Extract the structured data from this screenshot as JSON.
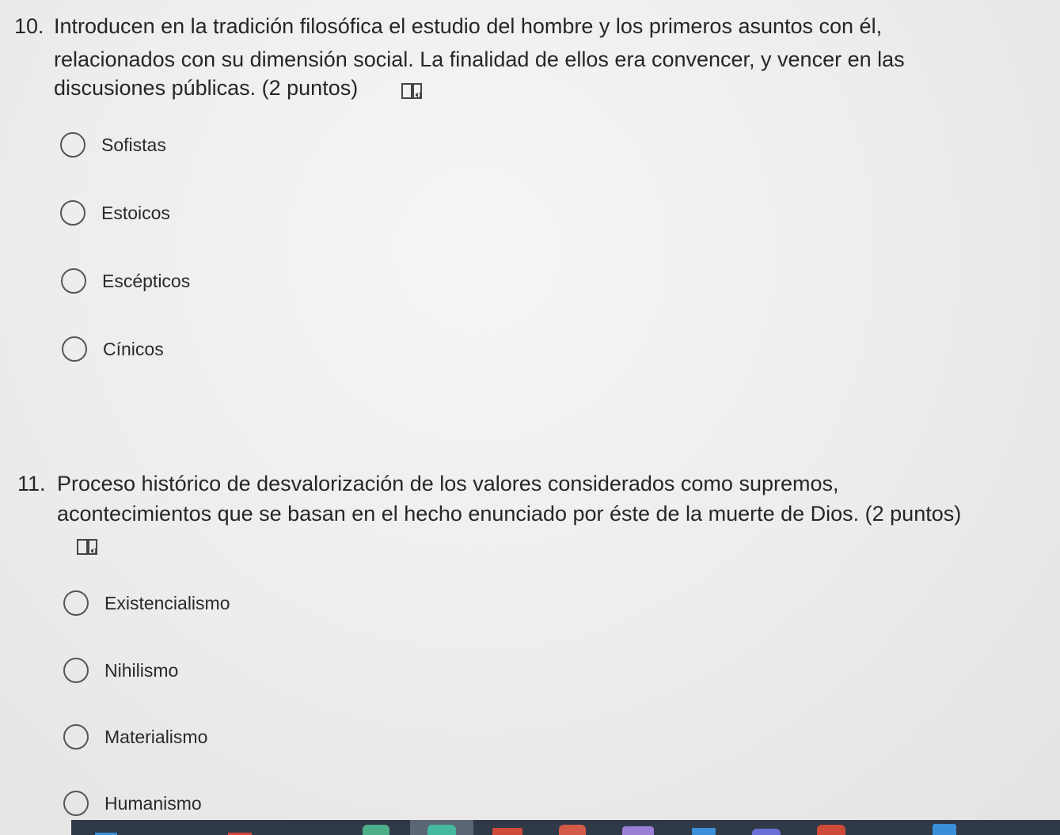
{
  "questions": [
    {
      "number": "10.",
      "text_lines": [
        "Introducen en la tradición filosófica el estudio del hombre y los primeros asuntos con él,",
        "relacionados con su dimensión social. La finalidad de ellos era convencer, y vencer en las",
        "discusiones públicas. (2 puntos)"
      ],
      "reader_icon": "immersive-reader-icon",
      "options": [
        "Sofistas",
        "Estoicos",
        "Escépticos",
        "Cínicos"
      ]
    },
    {
      "number": "11.",
      "text_lines": [
        "Proceso histórico de desvalorización de los valores considerados como supremos,",
        "acontecimientos que se basan en el hecho enunciado por éste de la muerte de Dios. (2 puntos)"
      ],
      "reader_icon": "immersive-reader-icon",
      "options": [
        "Existencialismo",
        "Nihilismo",
        "Materialismo",
        "Humanismo"
      ]
    }
  ],
  "taskbar": {
    "icons": [
      "app-icon",
      "app-icon",
      "app-icon",
      "browser-icon",
      "app-icon",
      "office-icon",
      "app-icon",
      "app-icon",
      "app-icon",
      "teams-icon",
      "chrome-icon",
      "app-icon"
    ],
    "colors": {
      "background": "#2f3947",
      "accent_red": "#d04a3a",
      "accent_green": "#4caf8a",
      "accent_blue": "#3a8fd8"
    }
  }
}
